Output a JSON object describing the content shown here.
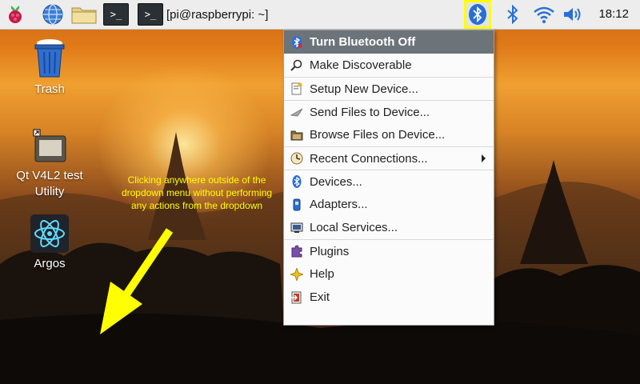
{
  "taskbar": {
    "terminal_prompt": ">_",
    "task_title": "[pi@raspberrypi: ~]",
    "clock": "18:12"
  },
  "desktop": {
    "items": [
      {
        "label": "Trash"
      },
      {
        "label": "Qt V4L2 test Utility"
      },
      {
        "label": "Argos"
      }
    ]
  },
  "annotation": {
    "text": "Clicking anywhere outside of the dropdown menu without performing any actions from the dropdown",
    "color": "#ffff00"
  },
  "bluetooth_menu": {
    "items": [
      {
        "label": "Turn Bluetooth Off",
        "icon": "bluetooth-off-icon",
        "active": true
      },
      {
        "label": "Make Discoverable",
        "icon": "search-icon"
      },
      {
        "label": "Setup New Device...",
        "icon": "setup-wizard-icon"
      },
      {
        "label": "Send Files to Device...",
        "icon": "send-files-icon"
      },
      {
        "label": "Browse Files on Device...",
        "icon": "folder-icon"
      },
      {
        "label": "Recent Connections...",
        "icon": "recent-icon",
        "submenu": true
      },
      {
        "label": "Devices...",
        "icon": "bluetooth-icon"
      },
      {
        "label": "Adapters...",
        "icon": "adapter-icon"
      },
      {
        "label": "Local Services...",
        "icon": "services-icon"
      },
      {
        "label": "Plugins",
        "icon": "puzzle-icon"
      },
      {
        "label": "Help",
        "icon": "help-icon"
      },
      {
        "label": "Exit",
        "icon": "exit-icon"
      }
    ]
  },
  "colors": {
    "taskbar_bg": "#ededed",
    "menu_active_bg": "#6d7479",
    "highlight_box": "#ffff00",
    "bluetooth_blue": "#2a6fd6"
  }
}
